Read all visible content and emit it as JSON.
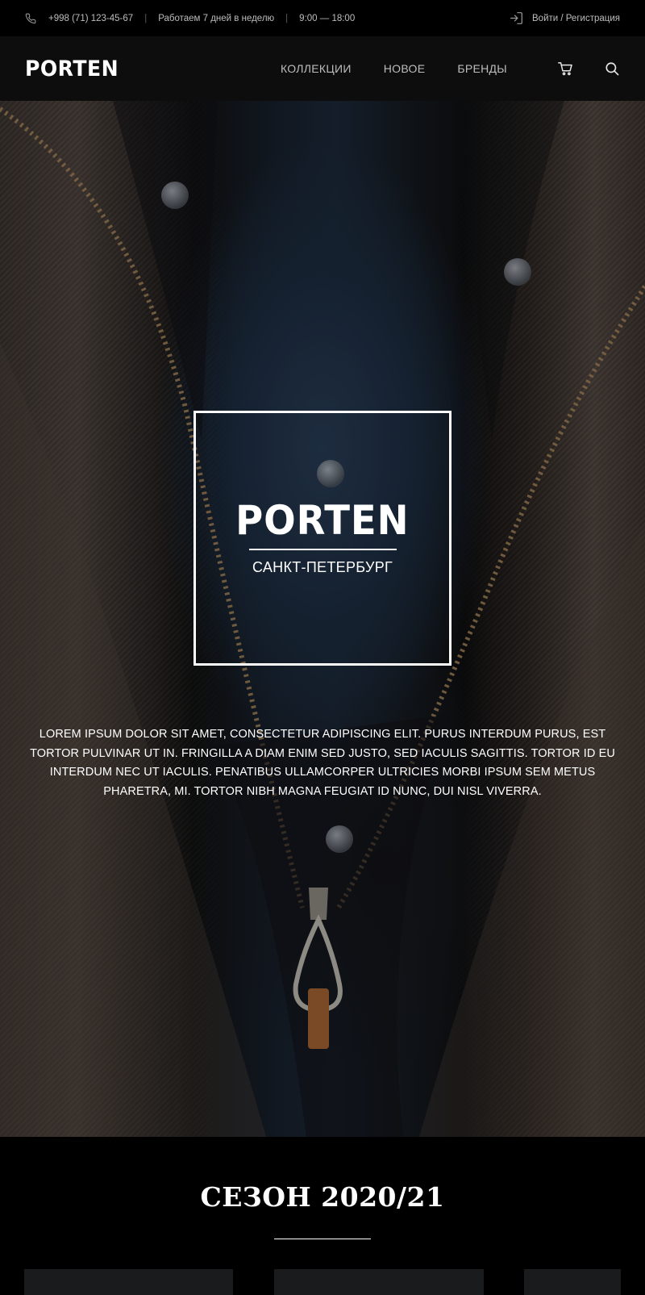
{
  "topbar": {
    "phone_icon": "phone-icon",
    "phone": "+998 (71) 123-45-67",
    "separator": "|",
    "schedule": "Работаем 7 дней в неделю",
    "hours": "9:00 — 18:00",
    "login_icon": "login-icon",
    "login_label": "Войти / Регистрация"
  },
  "header": {
    "logo": "PORTEN",
    "nav": [
      {
        "label": "КОЛЛЕКЦИИ"
      },
      {
        "label": "НОВОЕ"
      },
      {
        "label": "БРЕНДЫ"
      }
    ],
    "cart_icon": "cart-icon",
    "search_icon": "search-icon"
  },
  "hero": {
    "brand": "PORTEN",
    "city": "САНКТ-ПЕТЕРБУРГ",
    "text": "Lorem ipsum dolor sit amet, consectetur adipiscing elit. Purus interdum purus, est tortor pulvinar ut in. Fringilla a diam enim sed justo, sed iaculis sagittis. Tortor id eu interdum nec ut iaculis. Penatibus ullamcorper ultricies morbi ipsum sem metus pharetra, mi. Tortor nibh magna feugiat id nunc, dui nisl viverra."
  },
  "season": {
    "title": "СЕЗОН 2020/21"
  },
  "colors": {
    "background": "#000000",
    "header_bg": "#0d0d0e",
    "text": "#ffffff",
    "muted_text": "#bdbdbd",
    "card_bg": "#1a1b1d"
  }
}
